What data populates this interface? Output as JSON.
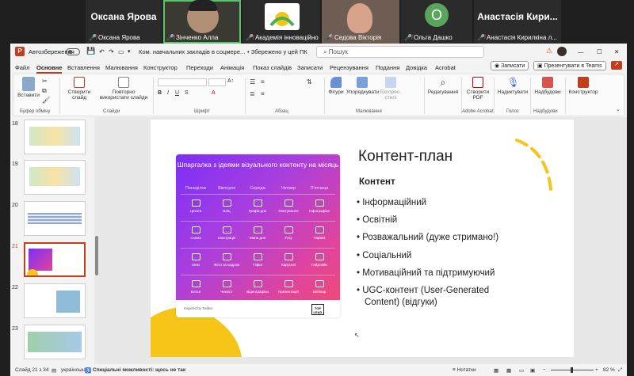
{
  "participants": [
    {
      "big_name": "Оксана Ярова",
      "label": "Оксана Ярова"
    },
    {
      "big_name": "",
      "label": "Зінченко Алла"
    },
    {
      "big_name": "",
      "label": "Академія інноваційно..."
    },
    {
      "big_name": "",
      "label": "Седова Вікторія"
    },
    {
      "big_name": "",
      "label": "Ольга Дашко"
    },
    {
      "big_name": "Анастасія Кири...",
      "label": "Анастасія Кирилкіна л..."
    }
  ],
  "avatar_letter": "О",
  "titlebar": {
    "autosave_label": "Автозбереження",
    "doc_title": "Ком. навчальних закладів в соцмере...",
    "saved_status": "• Збережено у цей ПК",
    "search_placeholder": "Пошук",
    "record_label": "Записати",
    "present_teams_label": "Презентувати в Teams"
  },
  "menu": [
    "Файл",
    "Основне",
    "Вставлення",
    "Малювання",
    "Конструктор",
    "Переходи",
    "Анімація",
    "Показ слайдів",
    "Записати",
    "Рецензування",
    "Подання",
    "Довідка",
    "Acrobat"
  ],
  "ribbon": {
    "paste": "Вставити",
    "clipboard_group": "Буфер обміну",
    "new_slide": "Створити слайд",
    "reuse_slides": "Повторно використати слайди",
    "slides_group": "Слайди",
    "font_group": "Шрифт",
    "paragraph_group": "Абзац",
    "shapes": "Фігури",
    "arrange": "Упорядкувати",
    "quick_styles": "Експрес-стилі",
    "drawing_group": "Малювання",
    "editing": "Редагування",
    "create_pdf": "Створити PDF",
    "acrobat_group": "Adobe Acrobat",
    "dictate": "Надиктувати",
    "voice_group": "Голос",
    "addins": "Надбудови",
    "addins_group": "Надбудови",
    "designer": "Конструктор"
  },
  "thumbnails": [
    "18",
    "19",
    "20",
    "21",
    "22",
    "23"
  ],
  "slide": {
    "card_title": "Шпаргалка з ідеями візуального контенту на місяць",
    "days": [
      "Понеділок",
      "Вівторок",
      "Середа",
      "Четвер",
      "П'ятниця"
    ],
    "cells": [
      "Цитата",
      "Бліц",
      "Графік дня",
      "Опитування",
      "Інфографіка",
      "Схема",
      "Ілюстрація",
      "Мапа дня",
      "FAQ",
      "Чарівні",
      "Мем",
      "Фото за кадром",
      "Гіфка",
      "Каруселі",
      "Гайдлайн",
      "Блоги",
      "Чекліст",
      "Відеографіка",
      "Презентація",
      "Вебінар"
    ],
    "inspired": "Inspired by Twitter",
    "toplead": "TOP LEAD",
    "heading": "Контент-план",
    "subheading": "Контент",
    "bullets": [
      "• Інформаційний",
      "• Освітній",
      "• Розважальний (дуже стримано!)",
      "• Соціальний",
      "• Мотиваційний та підтримуючий",
      "•  UGC-контент (User-Generated",
      "Content) (відгуки)"
    ]
  },
  "statusbar": {
    "slide_of": "Слайд 21 з 34",
    "language": "українська",
    "accessibility": "Спеціальні можливості: щось не так",
    "notes": "Нотатки",
    "zoom": "82 %"
  },
  "colors": {
    "accent": "#c43e1c",
    "slide_yellow": "#f5c518"
  }
}
